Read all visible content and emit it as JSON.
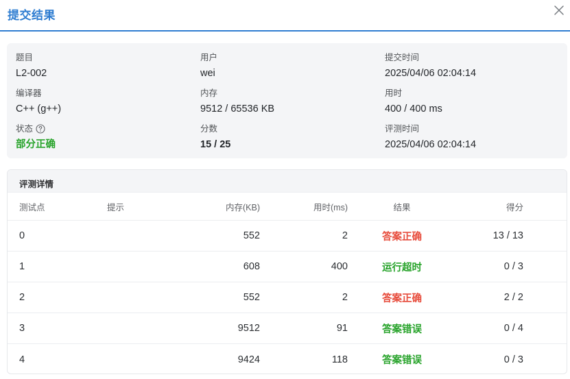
{
  "dialog": {
    "title": "提交结果",
    "close_label": "close"
  },
  "info": {
    "problem_label": "题目",
    "problem_value": "L2-002",
    "user_label": "用户",
    "user_value": "wei",
    "submit_time_label": "提交时间",
    "submit_time_value": "2025/04/06 02:04:14",
    "compiler_label": "编译器",
    "compiler_value": "C++ (g++)",
    "memory_label": "内存",
    "memory_value": "9512 / 65536 KB",
    "time_label": "用时",
    "time_value": "400 / 400 ms",
    "status_label": "状态",
    "status_value": "部分正确",
    "score_label": "分数",
    "score_value": "15 / 25",
    "judge_time_label": "评测时间",
    "judge_time_value": "2025/04/06 02:04:14"
  },
  "detail": {
    "title": "评测详情",
    "columns": [
      "测试点",
      "提示",
      "内存(KB)",
      "用时(ms)",
      "结果",
      "得分"
    ],
    "rows": [
      {
        "id": "0",
        "hint": "",
        "memory": "552",
        "time": "2",
        "result": "答案正确",
        "score": "13 / 13"
      },
      {
        "id": "1",
        "hint": "",
        "memory": "608",
        "time": "400",
        "result": "运行超时",
        "score": "0 / 3"
      },
      {
        "id": "2",
        "hint": "",
        "memory": "552",
        "time": "2",
        "result": "答案正确",
        "score": "2 / 2"
      },
      {
        "id": "3",
        "hint": "",
        "memory": "9512",
        "time": "91",
        "result": "答案错误",
        "score": "0 / 4"
      },
      {
        "id": "4",
        "hint": "",
        "memory": "9424",
        "time": "118",
        "result": "答案错误",
        "score": "0 / 3"
      }
    ]
  },
  "colors": {
    "accent": "#2f7dd1",
    "accepted": "#e74c3c",
    "failed": "#27a32a",
    "partial": "#27a32a"
  },
  "icons": {
    "close": "close-icon",
    "status_help": "question-circle-icon"
  }
}
